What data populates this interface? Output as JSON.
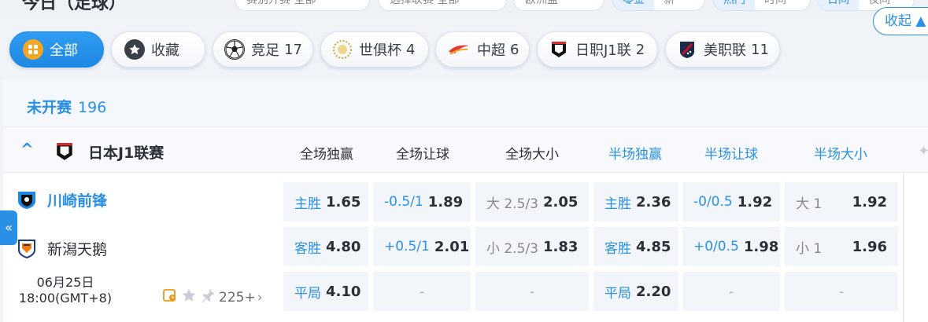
{
  "topbar": {
    "title": "今日（足球）",
    "filter1": "赛别开赛 全部",
    "filter2": "选择联赛 全部",
    "filter3": "欧洲盘",
    "seg1": [
      "零金",
      "新"
    ],
    "seg2": [
      "热门",
      "时间"
    ],
    "seg3": [
      "日间",
      "夜间"
    ]
  },
  "tabs": [
    {
      "label": "全部",
      "count": ""
    },
    {
      "label": "收藏",
      "count": ""
    },
    {
      "label": "竞足",
      "count": "17"
    },
    {
      "label": "世俱杯",
      "count": "4"
    },
    {
      "label": "中超",
      "count": "6"
    },
    {
      "label": "日职J1联",
      "count": "2"
    },
    {
      "label": "美职联",
      "count": "11"
    }
  ],
  "section": {
    "title": "未开赛",
    "count": "196",
    "collapse_label": "收起"
  },
  "league": {
    "name": "日本J1联赛",
    "columns": [
      "全场独赢",
      "全场让球",
      "全场大小",
      "半场独赢",
      "半场让球",
      "半场大小"
    ]
  },
  "match": {
    "home": "川崎前锋",
    "away": "新潟天鹅",
    "date": "06月25日",
    "time": "18:00(GMT+8)",
    "markets_count": "225+",
    "rows": [
      [
        {
          "label": "主胜",
          "value": "1.65"
        },
        {
          "label": "-0.5/1",
          "value": "1.89"
        },
        {
          "label": "大 2.5/3",
          "value": "2.05"
        },
        {
          "label": "主胜",
          "value": "2.36"
        },
        {
          "label": "-0/0.5",
          "value": "1.92"
        },
        {
          "label": "大 1",
          "value": "1.92"
        }
      ],
      [
        {
          "label": "客胜",
          "value": "4.80"
        },
        {
          "label": "+0.5/1",
          "value": "2.01"
        },
        {
          "label": "小 2.5/3",
          "value": "1.83"
        },
        {
          "label": "客胜",
          "value": "4.85"
        },
        {
          "label": "+0/0.5",
          "value": "1.98"
        },
        {
          "label": "小 1",
          "value": "1.96"
        }
      ],
      [
        {
          "label": "平局",
          "value": "4.10"
        },
        {
          "label": "",
          "value": "-"
        },
        {
          "label": "",
          "value": "-"
        },
        {
          "label": "平局",
          "value": "2.20"
        },
        {
          "label": "",
          "value": "-"
        },
        {
          "label": "",
          "value": "-"
        }
      ]
    ]
  },
  "side_tab_label": "«",
  "colors": {
    "accent": "#2a90e6",
    "cell_bg": "#f2f6fb"
  }
}
